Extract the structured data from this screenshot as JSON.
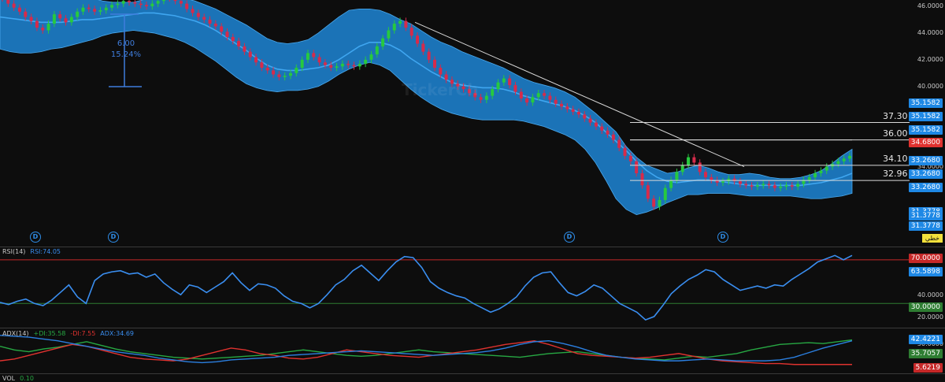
{
  "chart_data": [
    {
      "type": "line",
      "name": "price",
      "ylim": [
        30.4,
        46.5
      ],
      "y_axis_ticks": [
        "46.0000",
        "44.0000",
        "42.0000",
        "40.0000",
        "34.0000"
      ],
      "close": [
        46.6,
        46.2,
        45.9,
        45.6,
        45.2,
        44.9,
        44.4,
        44.2,
        44.7,
        45.4,
        45.1,
        44.8,
        45.2,
        45.6,
        45.9,
        45.8,
        45.6,
        45.7,
        45.9,
        46.1,
        46.2,
        46.4,
        46.3,
        46.2,
        46.1,
        46.0,
        46.2,
        46.4,
        46.7,
        46.6,
        46.4,
        46.2,
        45.8,
        45.5,
        45.2,
        45.0,
        44.7,
        44.5,
        44.1,
        43.7,
        43.4,
        43.0,
        42.6,
        42.2,
        41.8,
        41.4,
        41.2,
        40.9,
        40.7,
        40.8,
        41.0,
        41.4,
        42.0,
        42.5,
        42.2,
        41.8,
        41.6,
        41.4,
        41.5,
        41.7,
        41.6,
        41.5,
        41.7,
        42.0,
        42.4,
        43.0,
        43.6,
        44.2,
        44.7,
        44.9,
        44.4,
        43.8,
        43.2,
        42.6,
        42.0,
        41.4,
        40.9,
        40.5,
        40.2,
        40.0,
        39.8,
        39.5,
        39.2,
        39.0,
        39.3,
        39.8,
        40.3,
        40.6,
        40.1,
        39.6,
        39.1,
        38.8,
        39.2,
        39.5,
        39.3,
        39.0,
        38.7,
        38.5,
        38.3,
        38.1,
        37.9,
        37.6,
        37.3,
        37.0,
        36.7,
        36.4,
        36.0,
        35.4,
        34.8,
        34.4,
        33.5,
        32.6,
        31.6,
        31.0,
        31.5,
        32.4,
        33.0,
        33.6,
        34.1,
        34.7,
        34.3,
        33.6,
        33.2,
        33.0,
        32.8,
        32.9,
        33.1,
        32.9,
        32.7,
        32.6,
        32.5,
        32.6,
        32.7,
        32.6,
        32.4,
        32.5,
        32.6,
        32.5,
        32.7,
        33.0,
        33.2,
        33.5,
        33.7,
        34.0,
        34.2,
        34.4,
        34.6,
        34.8
      ],
      "ma_mid": [
        45.2,
        45.1,
        45.0,
        44.9,
        44.8,
        44.8,
        44.8,
        44.9,
        45.0,
        45.0,
        45.1,
        45.2,
        45.3,
        45.4,
        45.5,
        45.5,
        45.4,
        45.3,
        45.1,
        44.9,
        44.6,
        44.2,
        43.7,
        43.2,
        42.7,
        42.1,
        41.6,
        41.3,
        41.2,
        41.2,
        41.3,
        41.4,
        41.6,
        42.0,
        42.5,
        43.0,
        43.3,
        43.3,
        43.1,
        42.7,
        42.1,
        41.6,
        41.1,
        40.7,
        40.3,
        40.1,
        40.0,
        39.9,
        39.9,
        39.8,
        39.6,
        39.3,
        39.1,
        38.9,
        38.7,
        38.5,
        38.2,
        37.8,
        37.3,
        36.6,
        35.9,
        35.2,
        34.4,
        33.7,
        33.2,
        32.9,
        32.8,
        32.9,
        33.0,
        33.0,
        32.9,
        32.8,
        32.7,
        32.6,
        32.6,
        32.6,
        32.6,
        32.6,
        32.6,
        32.7,
        32.8,
        33.0,
        33.2,
        33.5
      ],
      "bb_upper": [
        47.2,
        47.0,
        46.9,
        46.9,
        46.8,
        46.8,
        46.9,
        46.9,
        46.8,
        46.6,
        46.4,
        46.3,
        46.3,
        46.3,
        46.5,
        46.7,
        46.9,
        46.9,
        46.6,
        46.4,
        46.1,
        45.8,
        45.4,
        45.0,
        44.6,
        44.1,
        43.6,
        43.3,
        43.2,
        43.3,
        43.5,
        44.0,
        44.6,
        45.2,
        45.7,
        45.8,
        45.8,
        45.7,
        45.4,
        45.0,
        44.7,
        44.2,
        43.7,
        43.3,
        43.0,
        42.6,
        42.3,
        42.0,
        41.7,
        41.4,
        41.0,
        40.6,
        40.3,
        40.1,
        39.9,
        39.6,
        39.2,
        38.6,
        38.0,
        37.3,
        36.6,
        35.5,
        34.7,
        34.1,
        33.8,
        33.5,
        33.6,
        33.9,
        34.1,
        33.9,
        33.6,
        33.4,
        33.4,
        33.5,
        33.4,
        33.2,
        33.1,
        33.1,
        33.2,
        33.4,
        33.7,
        34.2,
        34.8,
        35.3
      ],
      "bb_lower": [
        42.8,
        42.6,
        42.5,
        42.5,
        42.6,
        42.8,
        42.9,
        43.1,
        43.3,
        43.5,
        43.8,
        44.0,
        44.1,
        44.2,
        44.1,
        44.0,
        43.8,
        43.6,
        43.3,
        42.9,
        42.4,
        41.9,
        41.3,
        40.7,
        40.2,
        39.9,
        39.7,
        39.6,
        39.7,
        39.7,
        39.8,
        40.0,
        40.4,
        40.9,
        41.3,
        41.6,
        41.8,
        41.6,
        41.2,
        40.5,
        39.8,
        39.2,
        38.7,
        38.3,
        38.0,
        37.8,
        37.6,
        37.5,
        37.5,
        37.5,
        37.5,
        37.4,
        37.2,
        37.0,
        36.7,
        36.4,
        36.0,
        35.3,
        34.3,
        33.0,
        31.6,
        30.8,
        30.4,
        30.6,
        30.9,
        31.3,
        31.6,
        31.9,
        31.9,
        32.0,
        32.0,
        32.0,
        31.9,
        31.8,
        31.8,
        31.8,
        31.8,
        31.8,
        31.7,
        31.6,
        31.6,
        31.7,
        31.8,
        32.0
      ],
      "hlines": [
        {
          "label": "37.30",
          "value": 37.3
        },
        {
          "label": "36.00",
          "value": 36.0
        },
        {
          "label": "34.10",
          "value": 34.1
        },
        {
          "label": "32.96",
          "value": 32.96
        }
      ]
    },
    {
      "type": "line",
      "name": "RSI(14)",
      "ylim": [
        10,
        80
      ],
      "y_axis_ticks": [
        "40.0000",
        "20.0000"
      ],
      "levels": [
        70,
        30
      ],
      "values": [
        31,
        29,
        32,
        34,
        30,
        28,
        33,
        40,
        47,
        36,
        30,
        51,
        57,
        59,
        60,
        57,
        58,
        54,
        57,
        49,
        43,
        38,
        47,
        45,
        40,
        45,
        50,
        58,
        49,
        42,
        48,
        47,
        44,
        37,
        32,
        30,
        26,
        30,
        38,
        47,
        52,
        60,
        65,
        58,
        51,
        60,
        68,
        73,
        72,
        63,
        50,
        44,
        40,
        37,
        35,
        30,
        26,
        22,
        25,
        30,
        36,
        46,
        54,
        58,
        59,
        49,
        40,
        37,
        41,
        47,
        44,
        37,
        30,
        26,
        22,
        15,
        18,
        28,
        39,
        46,
        52,
        56,
        61,
        59,
        52,
        47,
        42,
        44,
        46,
        44,
        47,
        46,
        52,
        57,
        62,
        68,
        71,
        74,
        70,
        74
      ]
    },
    {
      "type": "line",
      "name": "ADX(14)",
      "ylim": [
        0,
        45
      ],
      "series": [
        {
          "name": "+DI",
          "values": [
            28,
            24,
            22,
            25,
            27,
            30,
            33,
            29,
            25,
            22,
            20,
            18,
            16,
            15,
            14,
            15,
            16,
            17,
            18,
            20,
            22,
            24,
            22,
            20,
            18,
            17,
            18,
            20,
            22,
            24,
            22,
            21,
            20,
            19,
            18,
            17,
            16,
            18,
            20,
            21,
            22,
            20,
            18,
            16,
            15,
            14,
            13,
            15,
            17,
            16,
            18,
            20,
            24,
            27,
            30,
            31,
            32,
            31,
            33,
            35
          ]
        },
        {
          "name": "-DI",
          "values": [
            12,
            14,
            18,
            22,
            26,
            30,
            28,
            24,
            20,
            16,
            14,
            13,
            12,
            14,
            18,
            22,
            26,
            24,
            20,
            18,
            15,
            14,
            16,
            20,
            24,
            22,
            20,
            18,
            17,
            16,
            18,
            20,
            22,
            24,
            27,
            30,
            32,
            34,
            30,
            25,
            20,
            18,
            17,
            16,
            15,
            16,
            18,
            20,
            17,
            14,
            12,
            11,
            10,
            9,
            9,
            8,
            8,
            8,
            8,
            8
          ]
        },
        {
          "name": "ADX",
          "values": [
            40,
            39,
            38,
            36,
            34,
            31,
            28,
            25,
            22,
            20,
            18,
            15,
            13,
            11,
            10,
            11,
            13,
            14,
            15,
            16,
            18,
            19,
            20,
            21,
            22,
            23,
            22,
            21,
            20,
            19,
            18,
            19,
            20,
            21,
            23,
            26,
            30,
            33,
            34,
            31,
            27,
            22,
            18,
            16,
            14,
            13,
            12,
            12,
            13,
            14,
            13,
            12,
            12,
            12,
            13,
            16,
            21,
            26,
            30,
            34
          ]
        }
      ]
    },
    {
      "type": "bar",
      "name": "VOL",
      "values": [
        0.1
      ]
    }
  ],
  "price_axis": {
    "tags": [
      {
        "text": "35.1582",
        "color": "#1e88e5"
      },
      {
        "text": "35.1582",
        "color": "#1e88e5"
      },
      {
        "text": "35.1582",
        "color": "#1e88e5"
      },
      {
        "text": "34.6800",
        "color": "#e0322f"
      },
      {
        "text": "33.2680",
        "color": "#1e88e5"
      },
      {
        "text": "33.2680",
        "color": "#1e88e5"
      },
      {
        "text": "33.2680",
        "color": "#1e88e5"
      },
      {
        "text": "31.3778",
        "color": "#1e88e5"
      },
      {
        "text": "31.3778",
        "color": "#1e88e5"
      },
      {
        "text": "31.3778",
        "color": "#1e88e5"
      }
    ],
    "badge": "خطي"
  },
  "measure": {
    "delta": "6.00",
    "percent": "15.24%"
  },
  "dividend_marker": "D",
  "watermark": "TickerCh",
  "rsi_pane": {
    "label": "RSI(14)",
    "value_text": "RSI:74.05",
    "tags": [
      "70.0000",
      "63.5898",
      "30.0000"
    ]
  },
  "adx_pane": {
    "label": "ADX(14)",
    "plus_di": "+DI:35.58",
    "minus_di": "-DI:7.55",
    "adx": "ADX:34.69",
    "tags": [
      "42.4221",
      "35.7057",
      "5.6219"
    ],
    "axis_tick": "30.0000"
  },
  "vol_pane": {
    "label": "VOL",
    "value_text": "0.10"
  },
  "colors": {
    "band": "#1f86d6",
    "mid": "#3fa6f0",
    "up": "#27c93f",
    "down": "#d62b4b",
    "rsi": "#3a8ef0",
    "rsi_upper": "#c62828",
    "rsi_lower": "#2e7d32",
    "plus_di": "#27a843",
    "minus_di": "#e0322f",
    "adx": "#2b7fe0"
  }
}
